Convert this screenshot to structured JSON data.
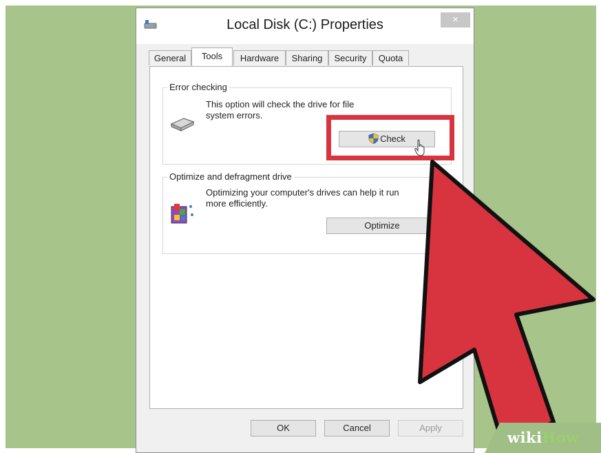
{
  "window": {
    "title": "Local Disk (C:) Properties",
    "close_label": "×"
  },
  "tabs": [
    {
      "label": "General",
      "active": false
    },
    {
      "label": "Tools",
      "active": true
    },
    {
      "label": "Hardware",
      "active": false
    },
    {
      "label": "Sharing",
      "active": false
    },
    {
      "label": "Security",
      "active": false
    },
    {
      "label": "Quota",
      "active": false
    }
  ],
  "error_checking": {
    "heading": "Error checking",
    "line1": "This option will check the drive for file",
    "line2": "system errors.",
    "button_label": "Check"
  },
  "optimize": {
    "heading": "Optimize and defragment drive",
    "line1": "Optimizing your computer's drives can help it run",
    "line2": "more efficiently.",
    "button_label": "Optimize"
  },
  "footer": {
    "ok_label": "OK",
    "cancel_label": "Cancel",
    "apply_label": "Apply"
  },
  "watermark": {
    "wiki": "wiki",
    "how": "How"
  },
  "colors": {
    "background": "#a7c48a",
    "highlight": "#d8343f",
    "arrow": "#d8343f"
  }
}
